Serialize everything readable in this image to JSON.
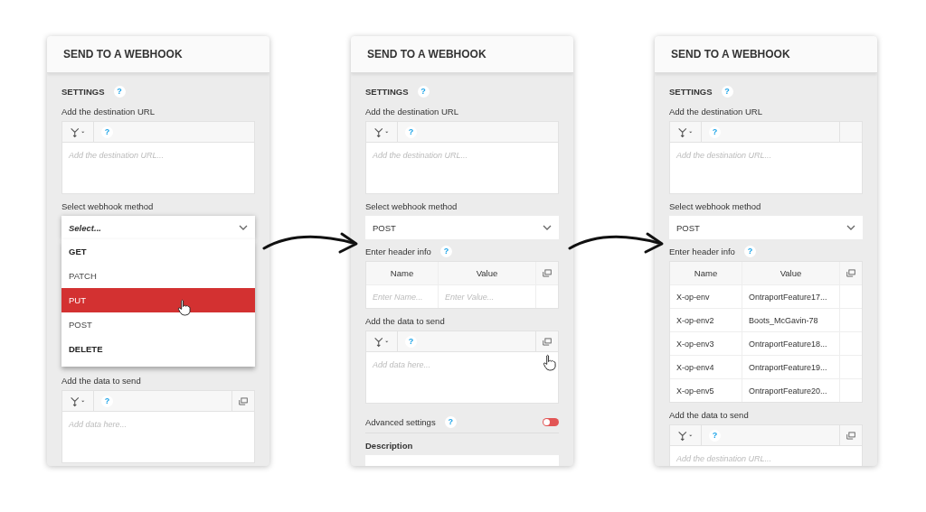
{
  "panels": [
    {
      "title": "SEND TO A WEBHOOK",
      "settings": {
        "label": "SETTINGS",
        "help": "?"
      },
      "sections": [
        {
          "kind": "editor",
          "label": "Add the destination URL",
          "help": "?",
          "placeholder": "Add the destination URL...",
          "expand_button": false,
          "blank_slot": false,
          "hovered": false
        },
        {
          "kind": "dropdown",
          "label": "Select webhook method",
          "value": "Select...",
          "open": true,
          "options": [
            {
              "label": "GET",
              "bold": true,
              "selected": false,
              "hovered": false
            },
            {
              "label": "PATCH",
              "bold": false,
              "selected": false,
              "hovered": false
            },
            {
              "label": "PUT",
              "bold": false,
              "selected": true,
              "hovered": true
            },
            {
              "label": "POST",
              "bold": false,
              "selected": false,
              "hovered": false
            },
            {
              "label": "DELETE",
              "bold": true,
              "selected": false,
              "hovered": false
            }
          ]
        },
        {
          "kind": "editor",
          "label": "Add the data to send",
          "help": "?",
          "placeholder": "Add data here...",
          "expand_button": true,
          "blank_slot": false,
          "hovered": false
        }
      ]
    },
    {
      "title": "SEND TO A WEBHOOK",
      "settings": {
        "label": "SETTINGS",
        "help": "?"
      },
      "sections": [
        {
          "kind": "editor",
          "label": "Add the destination URL",
          "help": "?",
          "placeholder": "Add the destination URL...",
          "expand_button": false,
          "blank_slot": false,
          "hovered": false
        },
        {
          "kind": "dropdown",
          "label": "Select webhook method",
          "value": "POST",
          "open": false
        },
        {
          "kind": "headers",
          "label": "Enter header info",
          "help": "?",
          "columns": [
            "Name",
            "Value"
          ],
          "rows": [
            {
              "name_placeholder": "Enter Name...",
              "value_placeholder": "Enter Value..."
            }
          ]
        },
        {
          "kind": "editor",
          "label": "Add the data to send",
          "help": "?",
          "placeholder": "Add data here...",
          "expand_button": true,
          "blank_slot": false,
          "hovered": true
        },
        {
          "kind": "toggle",
          "label": "Advanced settings",
          "help": "?",
          "on": false
        },
        {
          "kind": "field",
          "label": "Description"
        }
      ]
    },
    {
      "title": "SEND TO A WEBHOOK",
      "settings": {
        "label": "SETTINGS",
        "help": "?"
      },
      "sections": [
        {
          "kind": "editor",
          "label": "Add the destination URL",
          "help": "?",
          "placeholder": "Add the destination URL...",
          "expand_button": false,
          "blank_slot": true,
          "hovered": false
        },
        {
          "kind": "dropdown",
          "label": "Select webhook method",
          "value": "POST",
          "open": false
        },
        {
          "kind": "headers",
          "label": "Enter header info",
          "help": "?",
          "columns": [
            "Name",
            "Value"
          ],
          "rows": [
            {
              "name": "X-op-env",
              "value": "OntraportFeature17..."
            },
            {
              "name": "X-op-env2",
              "value": "Boots_McGavin-78"
            },
            {
              "name": "X-op-env3",
              "value": "OntraportFeature18..."
            },
            {
              "name": "X-op-env4",
              "value": "OntraportFeature19..."
            },
            {
              "name": "X-op-env5",
              "value": "OntraportFeature20..."
            }
          ]
        },
        {
          "kind": "editor",
          "label": "Add the data to send",
          "help": "?",
          "placeholder": "Add the destination URL...",
          "expand_button": true,
          "blank_slot": false,
          "hovered": false
        }
      ]
    }
  ]
}
